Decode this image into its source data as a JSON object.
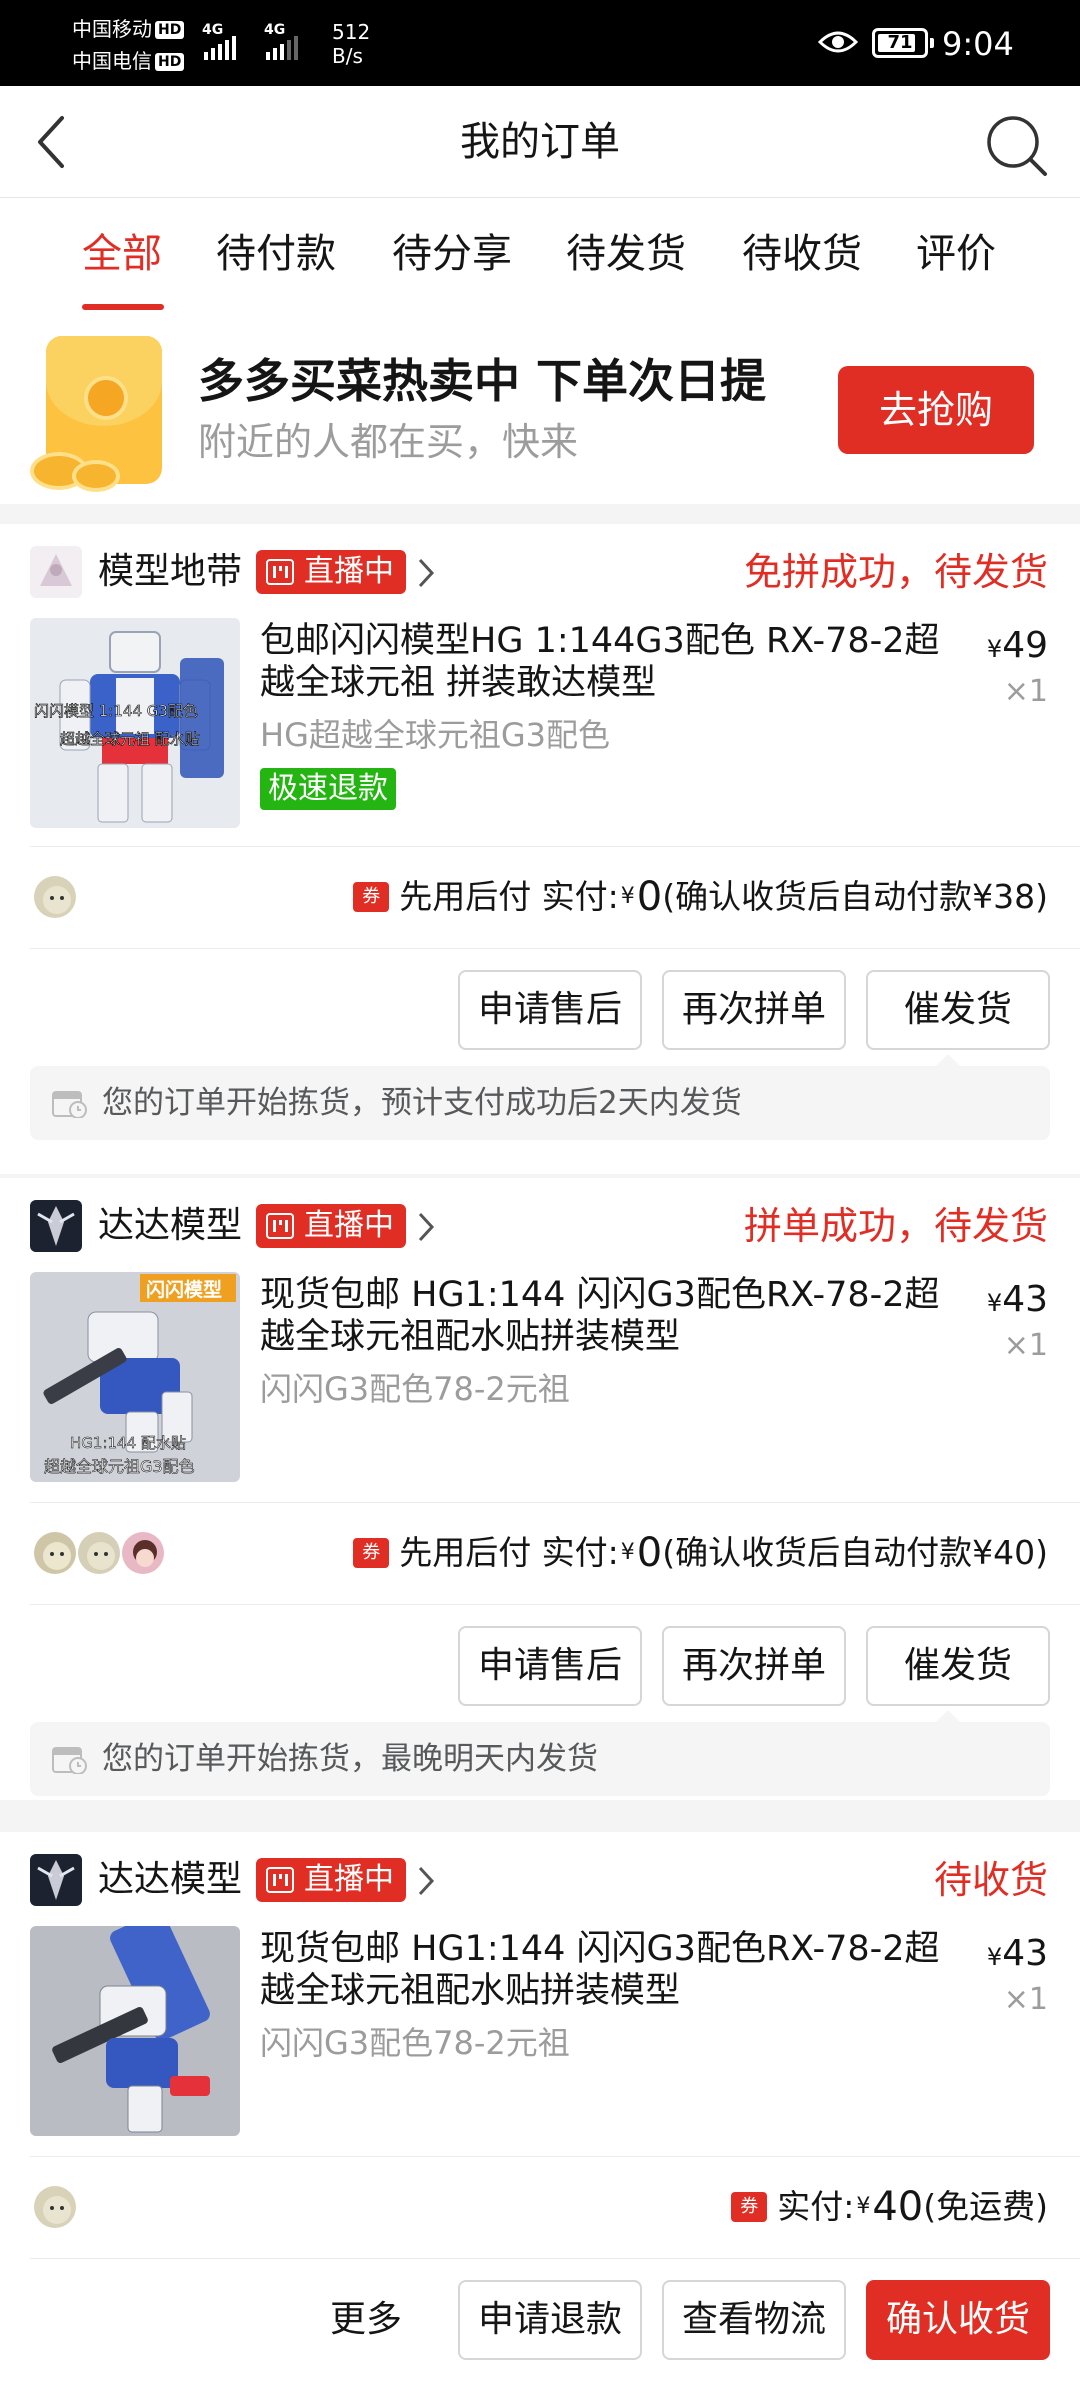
{
  "status_bar": {
    "carrier1": "中国移动",
    "carrier2": "中国电信",
    "hd": "HD",
    "net1": "4G",
    "net2": "4G",
    "speed": "512",
    "speed_unit": "B/s",
    "battery": "71",
    "time": "9:04"
  },
  "nav": {
    "title": "我的订单"
  },
  "tabs": [
    {
      "label": "全部",
      "active": true
    },
    {
      "label": "待付款"
    },
    {
      "label": "待分享"
    },
    {
      "label": "待发货"
    },
    {
      "label": "待收货"
    },
    {
      "label": "评价"
    }
  ],
  "promo": {
    "title": "多多买菜热卖中 下单次日提",
    "subtitle": "附近的人都在买，快来",
    "button": "去抢购"
  },
  "orders": [
    {
      "shop": "模型地带",
      "live": "直播中",
      "status": "免拼成功，待发货",
      "title": "包邮闪闪模型HG 1:144G3配色 RX-78-2超越全球元祖 拼装敢达模型",
      "sku": "HG超越全球元祖G3配色",
      "tag": "极速退款",
      "currency": "¥",
      "price": "49",
      "qty": "×1",
      "coupon": "券",
      "pay_prefix": "先用后付 实付:",
      "pay_yen": "¥",
      "pay_amount": "0",
      "pay_suffix": "(确认收货后自动付款¥38)",
      "thumb_text1": "闪闪模型 1:144 G3配色",
      "thumb_text2": "超越全球元祖 配水贴",
      "buttons": [
        "申请售后",
        "再次拼单",
        "催发货"
      ],
      "note": "您的订单开始拣货，预计支付成功后2天内发货"
    },
    {
      "shop": "达达模型",
      "live": "直播中",
      "status": "拼单成功，待发货",
      "title": "现货包邮 HG1:144 闪闪G3配色RX-78-2超越全球元祖配水贴拼装模型",
      "sku": "闪闪G3配色78-2元祖",
      "currency": "¥",
      "price": "43",
      "qty": "×1",
      "coupon": "券",
      "pay_prefix": "先用后付 实付:",
      "pay_yen": "¥",
      "pay_amount": "0",
      "pay_suffix": "(确认收货后自动付款¥40)",
      "thumb_text1": "闪闪模型",
      "thumb_text2": "HG1:144 配水贴",
      "thumb_text3": "超越全球元祖G3配色",
      "buttons": [
        "申请售后",
        "再次拼单",
        "催发货"
      ],
      "note": "您的订单开始拣货，最晚明天内发货"
    },
    {
      "shop": "达达模型",
      "live": "直播中",
      "status": "待收货",
      "title": "现货包邮 HG1:144 闪闪G3配色RX-78-2超越全球元祖配水贴拼装模型",
      "sku": "闪闪G3配色78-2元祖",
      "currency": "¥",
      "price": "43",
      "qty": "×1",
      "coupon": "券",
      "pay_prefix": "实付:",
      "pay_yen": "¥",
      "pay_amount": "40",
      "pay_suffix": "(免运费)",
      "more": "更多",
      "buttons": [
        "申请退款",
        "查看物流",
        "确认收货"
      ]
    }
  ],
  "colors": {
    "accent": "#e02e24",
    "green": "#25b513",
    "muted": "#9c9c9c"
  }
}
